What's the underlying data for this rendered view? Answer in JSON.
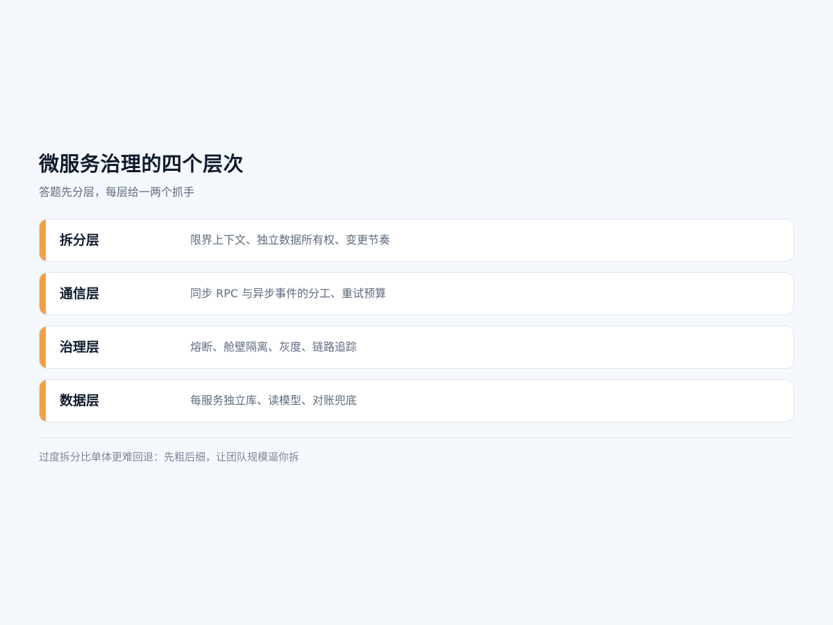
{
  "header": {
    "title": "微服务治理的四个层次",
    "subtitle": "答题先分层，每层给一两个抓手"
  },
  "layers": [
    {
      "name": "拆分层",
      "desc": "限界上下文、独立数据所有权、变更节奏"
    },
    {
      "name": "通信层",
      "desc": "同步 RPC 与异步事件的分工、重试预算"
    },
    {
      "name": "治理层",
      "desc": "熔断、舱壁隔离、灰度、链路追踪"
    },
    {
      "name": "数据层",
      "desc": "每服务独立库、读模型、对账兜底"
    }
  ],
  "footer": {
    "note": "过度拆分比单体更难回退：先粗后细，让团队规模逼你拆"
  },
  "colors": {
    "accent": "#f29e4c",
    "background": "#f5f8fc",
    "title": "#0f1b2d",
    "muted": "#5d6b7e"
  }
}
